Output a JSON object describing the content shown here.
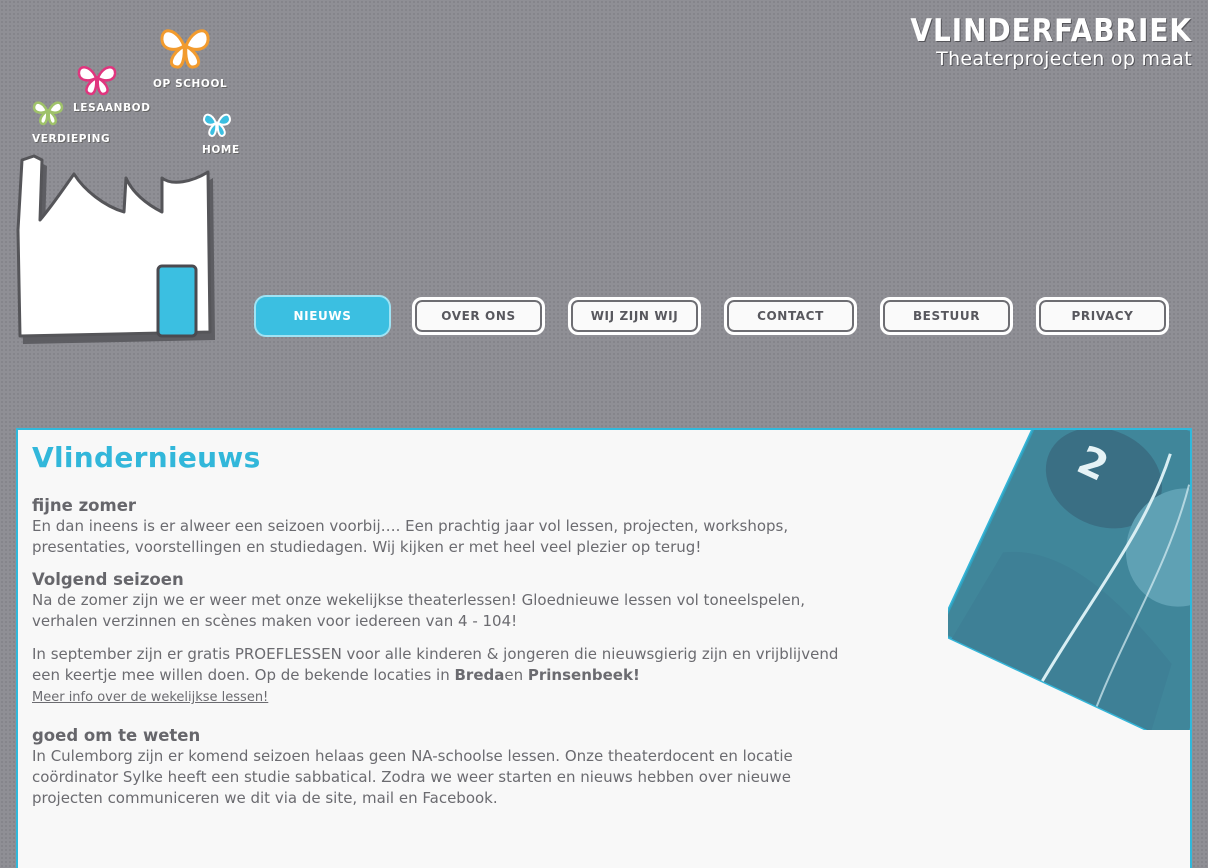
{
  "brand": {
    "name": "VLINDERFABRIEK",
    "tagline": "Theaterprojecten op maat"
  },
  "side_nav": {
    "verdieping": "VERDIEPING",
    "lesaanbod": "LESAANBOD",
    "op_school": "OP SCHOOL",
    "home": "HOME"
  },
  "nav": {
    "items": [
      {
        "label": "NIEUWS",
        "active": true
      },
      {
        "label": "OVER ONS"
      },
      {
        "label": "WIJ ZIJN WIJ"
      },
      {
        "label": "CONTACT"
      },
      {
        "label": "BESTUUR"
      },
      {
        "label": "PRIVACY"
      }
    ]
  },
  "page": {
    "title": "Vlindernieuws",
    "sections": [
      {
        "heading": "fijne zomer",
        "text": "En dan ineens is er alweer een seizoen voorbij…. Een prachtig jaar vol lessen, projecten, workshops, presentaties, voorstellingen en studiedagen. Wij kijken er met heel veel plezier op terug!"
      },
      {
        "heading": "Volgend seizoen",
        "text": "Na de zomer zijn we er weer met onze wekelijkse theaterlessen! Gloednieuwe lessen vol toneelspelen, verhalen verzinnen en scènes maken voor iedereen van 4 - 104!",
        "text2_pre": "In september zijn er gratis PROEFLESSEN voor alle kinderen & jongeren die nieuwsgierig zijn en vrijblijvend een keertje mee willen doen. Op de bekende locaties in ",
        "breda": "Breda",
        "en": "en ",
        "prinsenbeek": "Prinsenbeek!",
        "link": "Meer info over de wekelijkse lessen!"
      },
      {
        "heading": "goed om te weten",
        "text": "In Culemborg zijn er komend seizoen helaas geen NA-schoolse lessen. Onze theaterdocent en locatie coördinator Sylke heeft een studie sabbatical. Zodra we weer starten en nieuws hebben over nieuwe projecten communiceren we dit via de site, mail en Facebook."
      }
    ],
    "photo_number": "2"
  },
  "colors": {
    "accent": "#32b7da",
    "background": "#8f8f95",
    "panel": "#f8f8f8",
    "text": "#6b6b70"
  }
}
